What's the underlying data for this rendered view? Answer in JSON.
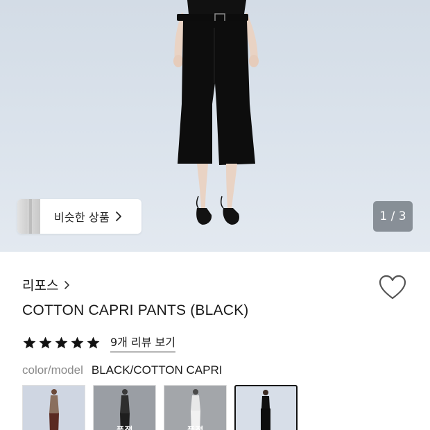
{
  "gallery": {
    "similar_label": "비슷한 상품",
    "counter": "1 / 3"
  },
  "product": {
    "brand": "리포스",
    "title": "COTTON CAPRI PANTS (BLACK)",
    "rating_stars": 5,
    "review_link": "9개 리뷰 보기"
  },
  "option": {
    "label": "color/model",
    "value": "BLACK/COTTON CAPRI"
  },
  "swatches": [
    {
      "overlay": "",
      "bg": "#cfd6e2",
      "selected": false
    },
    {
      "overlay": "품절",
      "bg": "#9a9ea4",
      "selected": false
    },
    {
      "overlay": "품절",
      "bg": "#a3a6aa",
      "selected": false
    },
    {
      "overlay": "",
      "bg": "#d7dee8",
      "selected": true
    }
  ],
  "icons": {
    "similar": "chevron-right-icon",
    "brand": "chevron-right-icon",
    "wish": "heart-outline-icon",
    "rating": "star-filled-icon"
  },
  "colors": {
    "hero_bg": "#d9e1ea",
    "counter_bg": "#6e767e",
    "text": "#1a1a1a",
    "muted": "#8a8a8a"
  }
}
